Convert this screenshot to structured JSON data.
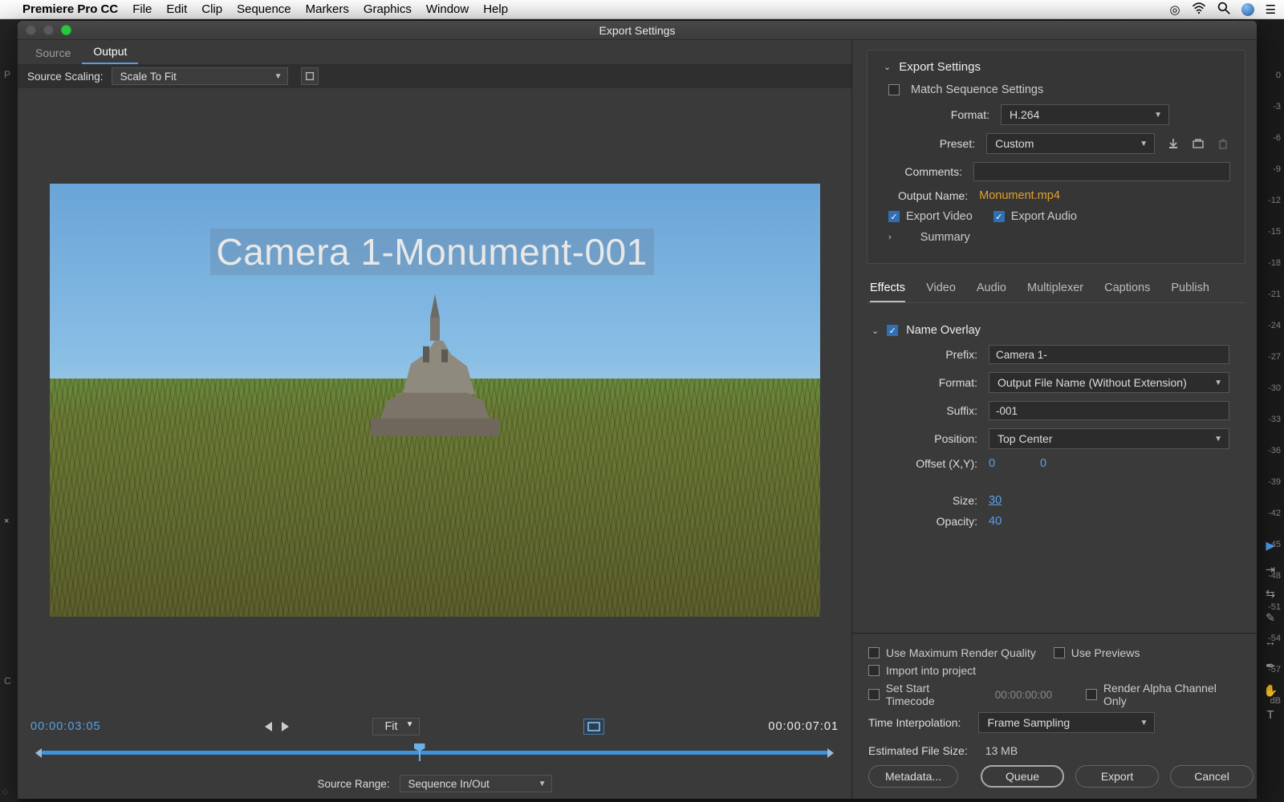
{
  "mac_menu": {
    "app": "Premiere Pro CC",
    "items": [
      "File",
      "Edit",
      "Clip",
      "Sequence",
      "Markers",
      "Graphics",
      "Window",
      "Help"
    ]
  },
  "window_title": "Export Settings",
  "left": {
    "tabs": {
      "source": "Source",
      "output": "Output"
    },
    "scaling_label": "Source Scaling:",
    "scaling_value": "Scale To Fit",
    "overlay_text": "Camera 1-Monument-001",
    "tc_left": "00:00:03:05",
    "fit_label": "Fit",
    "tc_right": "00:00:07:01",
    "source_range_label": "Source Range:",
    "source_range_value": "Sequence In/Out"
  },
  "export": {
    "header": "Export Settings",
    "match_seq": "Match Sequence Settings",
    "format_label": "Format:",
    "format_value": "H.264",
    "preset_label": "Preset:",
    "preset_value": "Custom",
    "comments_label": "Comments:",
    "output_name_label": "Output Name:",
    "output_name_value": "Monument.mp4",
    "export_video": "Export Video",
    "export_audio": "Export Audio",
    "summary": "Summary"
  },
  "tabs2": [
    "Effects",
    "Video",
    "Audio",
    "Multiplexer",
    "Captions",
    "Publish"
  ],
  "name_overlay": {
    "header": "Name Overlay",
    "prefix_label": "Prefix:",
    "prefix_value": "Camera 1-",
    "format_label": "Format:",
    "format_value": "Output File Name (Without Extension)",
    "suffix_label": "Suffix:",
    "suffix_value": "-001",
    "position_label": "Position:",
    "position_value": "Top Center",
    "offset_label": "Offset (X,Y):",
    "offset_x": "0",
    "offset_y": "0",
    "size_label": "Size:",
    "size_value": "30",
    "opacity_label": "Opacity:",
    "opacity_value": "40"
  },
  "bottom": {
    "max_render": "Use Maximum Render Quality",
    "use_previews": "Use Previews",
    "import_project": "Import into project",
    "set_start_tc": "Set Start Timecode",
    "start_tc": "00:00:00:00",
    "render_alpha": "Render Alpha Channel Only",
    "time_interp_label": "Time Interpolation:",
    "time_interp_value": "Frame Sampling",
    "est_size_label": "Estimated File Size:",
    "est_size_value": "13 MB",
    "btn_metadata": "Metadata...",
    "btn_queue": "Queue",
    "btn_export": "Export",
    "btn_cancel": "Cancel"
  },
  "meters": [
    "0",
    "-3",
    "-6",
    "-9",
    "-12",
    "-15",
    "-18",
    "-21",
    "-24",
    "-27",
    "-30",
    "-33",
    "-36",
    "-39",
    "-42",
    "-45",
    "-48",
    "-51",
    "-54",
    "-57",
    "dB"
  ]
}
